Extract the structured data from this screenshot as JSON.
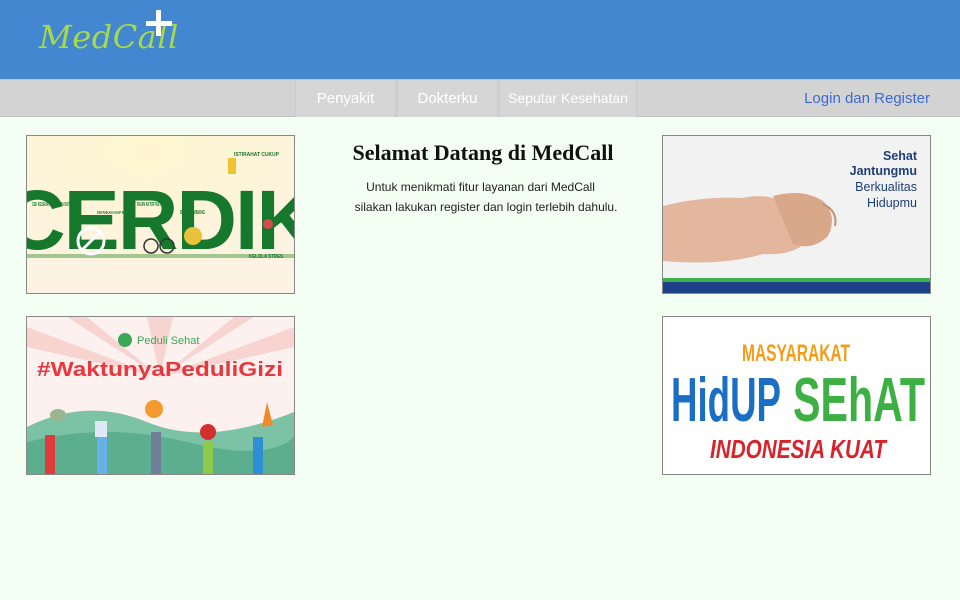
{
  "header": {
    "logo_text": "MedCall"
  },
  "nav": {
    "items": [
      "Penyakit",
      "Dokterku",
      "Seputar Kesehatan"
    ],
    "login_label": "Login dan Register"
  },
  "welcome": {
    "title": "Selamat Datang di MedCall",
    "line1": "Untuk menikmati fitur layanan dari MedCall",
    "line2": "silakan lakukan register dan login terlebih dahulu."
  },
  "banners": {
    "cerdik": {
      "word": "CERDIK",
      "cek": "CEK KESEHATAN SECARA RUTIN",
      "enyahkan": "ENYAHKAN ASAP ROKOK",
      "rajin": "RAJIN AKTIFITAS FISIK",
      "diet": "DIET SEIMBANG",
      "istirahat": "ISTIRAHAT CUKUP",
      "kelola": "KELOLA STRES"
    },
    "gizi": {
      "brand": "Peduli Sehat",
      "hashtag": "#WaktunyaPeduliGizi"
    },
    "jantung": {
      "line1": "Sehat",
      "line2": "Jantungmu",
      "line3": "Berkualitas",
      "line4": "Hidupmu"
    },
    "masyarakat": {
      "line1": "MASYARAKAT",
      "line2a": "HidUP",
      "line2b": "SEhAT",
      "line3": "INDONESIA KUAT"
    }
  },
  "colors": {
    "header_bg": "#4287cf",
    "logo": "#a7d94a",
    "nav_bg": "#d3d3d3",
    "link": "#3d6bd6",
    "page_bg": "#f2fff2"
  }
}
